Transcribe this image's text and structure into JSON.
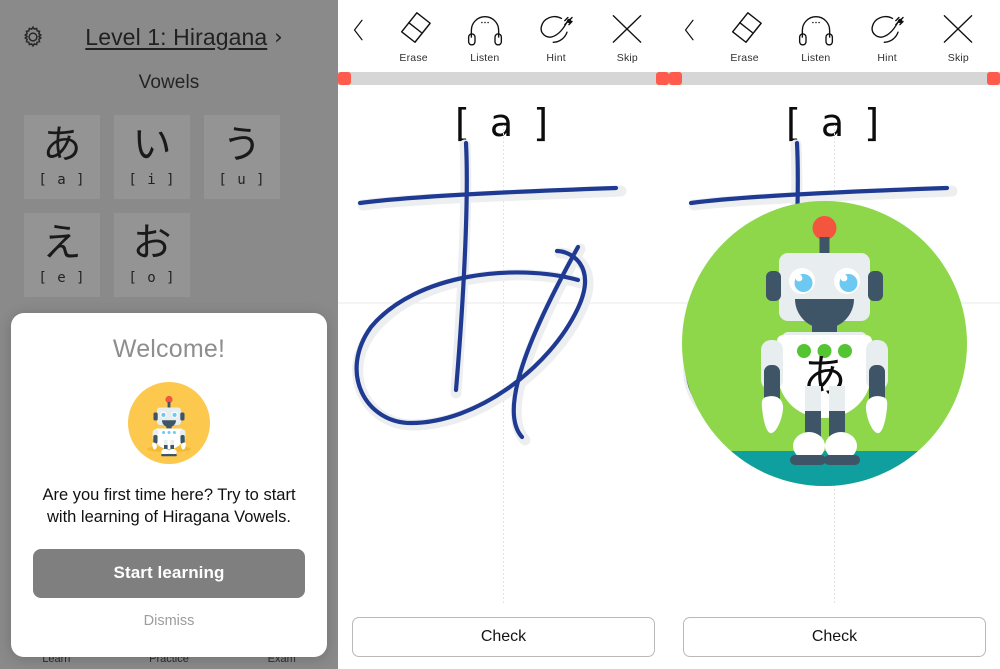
{
  "left_panel": {
    "gear_icon": "gear-icon",
    "level_title": "Level 1: Hiragana",
    "level_chevron": "›",
    "section_title": "Vowels",
    "tiles": [
      {
        "kana": "あ",
        "romaji": "[ a ]"
      },
      {
        "kana": "い",
        "romaji": "[ i ]"
      },
      {
        "kana": "う",
        "romaji": "[ u ]"
      },
      {
        "kana": "え",
        "romaji": "[ e ]"
      },
      {
        "kana": "お",
        "romaji": "[ o ]"
      }
    ],
    "tabs": [
      {
        "label": "Learn"
      },
      {
        "label": "Practice"
      },
      {
        "label": "Exam"
      }
    ]
  },
  "modal": {
    "title": "Welcome!",
    "avatar_icon": "robot-avatar-icon",
    "body": "Are you first time here? Try to start with learning of Hiragana Vowels.",
    "primary_label": "Start learning",
    "dismiss_label": "Dismiss"
  },
  "practice_mid": {
    "back_icon": "back-chevron-icon",
    "tools": [
      {
        "name": "eraser-icon",
        "label": "Erase"
      },
      {
        "name": "headphones-icon",
        "label": "Listen"
      },
      {
        "name": "hint-pen-icon",
        "label": "Hint"
      },
      {
        "name": "skip-x-icon",
        "label": "Skip"
      }
    ],
    "kana_label": "[ a ]",
    "check_label": "Check",
    "target_kana": "あ"
  },
  "practice_right": {
    "back_icon": "back-chevron-icon",
    "tools": [
      {
        "name": "eraser-icon",
        "label": "Erase"
      },
      {
        "name": "headphones-icon",
        "label": "Listen"
      },
      {
        "name": "hint-pen-icon",
        "label": "Hint"
      },
      {
        "name": "skip-x-icon",
        "label": "Skip"
      }
    ],
    "kana_label": "[ a ]",
    "check_label": "Check",
    "target_kana": "あ",
    "robot_badge_kana": "あ"
  },
  "colors": {
    "panel_bg": "#9a9a9a",
    "tile_bg": "#a6a6a6",
    "ink_blue": "#1f3a93",
    "ghost_gray": "#eceef0",
    "progress_red": "#ff5b4d",
    "progress_track": "#d6d6d6",
    "badge_green": "#8ed64a",
    "avatar_yellow": "#fcc84d",
    "robot_dark": "#3d5567",
    "robot_light": "#e8edf0",
    "teal_base": "#0f9f9f"
  }
}
